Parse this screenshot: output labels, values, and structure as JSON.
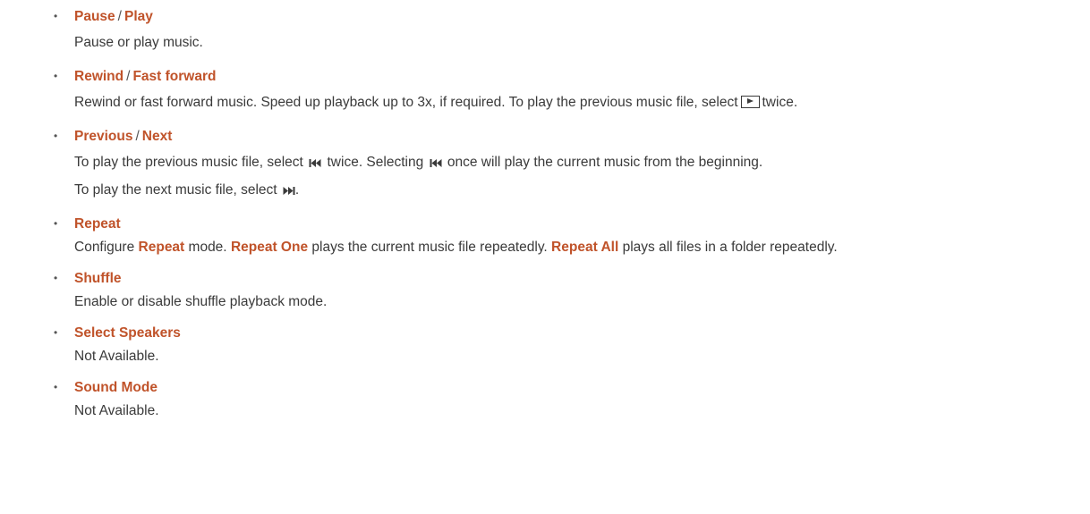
{
  "items": [
    {
      "title_a": "Pause",
      "sep": "/",
      "title_b": "Play",
      "desc": "Pause or play music."
    },
    {
      "title_a": "Rewind",
      "sep": "/",
      "title_b": "Fast forward",
      "desc_before_icon": "Rewind or fast forward music. Speed up playback up to 3x, if required. To play the previous music file, select",
      "icon": "play-button-icon",
      "desc_after_icon": "twice."
    },
    {
      "title_a": "Previous",
      "sep": "/",
      "title_b": "Next",
      "line1_a": "To play the previous music file, select",
      "line1_icon": "skip-previous-icon",
      "line1_b": "twice. Selecting",
      "line1_icon2": "skip-previous-icon",
      "line1_c": "once will play the current music from the beginning.",
      "line2_a": "To play the next music file, select",
      "line2_icon": "skip-next-icon",
      "line2_b": "."
    },
    {
      "title": "Repeat",
      "desc_a": "Configure",
      "desc_kw1": "Repeat",
      "desc_b": "mode.",
      "desc_kw2": "Repeat One",
      "desc_c": "plays the current music file repeatedly.",
      "desc_kw3": "Repeat All",
      "desc_d": "plays all files in a folder repeatedly."
    },
    {
      "title": "Shuffle",
      "desc": "Enable or disable shuffle playback mode."
    },
    {
      "title": "Select Speakers",
      "desc": "Not Available."
    },
    {
      "title": "Sound Mode",
      "desc": "Not Available."
    }
  ],
  "bullet": "•",
  "colors": {
    "keyword": "#c0532a",
    "text": "#3a3a3a"
  }
}
